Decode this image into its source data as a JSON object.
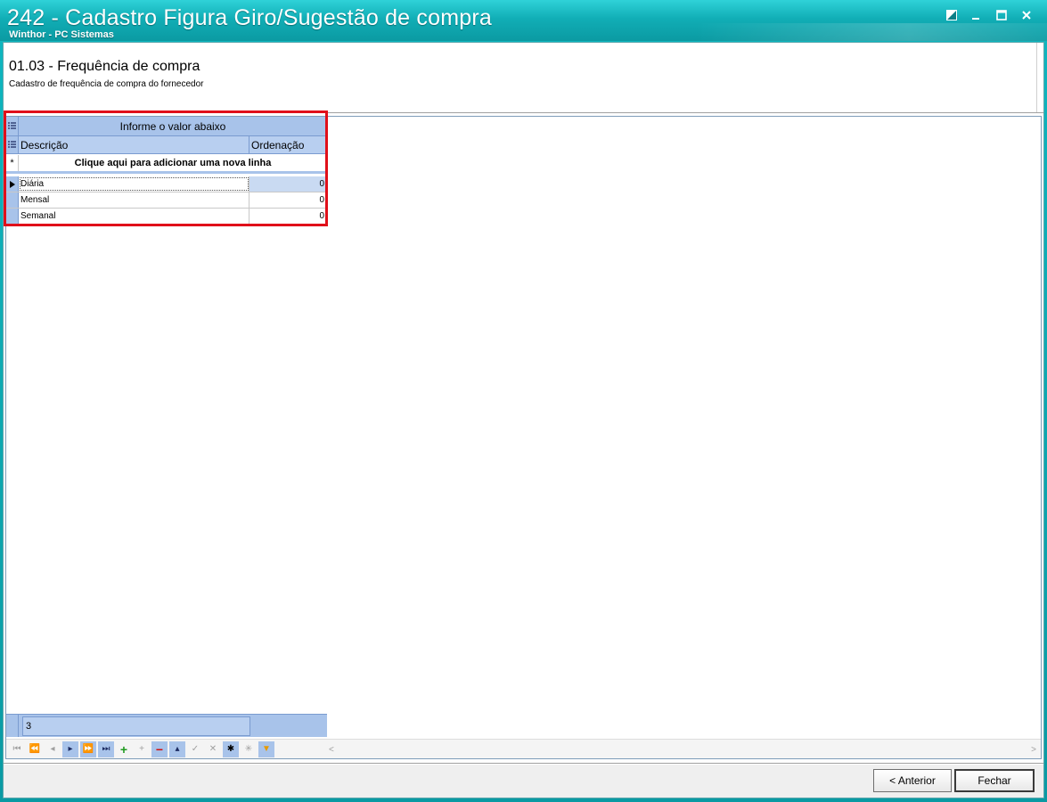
{
  "window": {
    "title": "242 - Cadastro Figura Giro/Sugestão de compra",
    "subtitle": "Winthor - PC Sistemas",
    "controls": [
      "restore-down",
      "minimize",
      "maximize",
      "close"
    ]
  },
  "header": {
    "step_title": "01.03 - Frequência de compra",
    "step_desc": "Cadastro de frequência de compra do fornecedor"
  },
  "grid": {
    "group_header": "Informe o valor abaixo",
    "columns": [
      "Descrição",
      "Ordenação"
    ],
    "new_row_text": "Clique aqui para adicionar uma nova linha",
    "new_row_marker": "*",
    "rows": [
      {
        "descricao": "Diária",
        "ordenacao": "0"
      },
      {
        "descricao": "Mensal",
        "ordenacao": "0"
      },
      {
        "descricao": "Semanal",
        "ordenacao": "0"
      }
    ],
    "selected_row": 0,
    "footer_count": "3"
  },
  "navigator": {
    "buttons": [
      "first",
      "prev-page",
      "prev",
      "next",
      "next-page",
      "last",
      "insert",
      "append",
      "delete",
      "edit",
      "post",
      "cancel",
      "bookmark",
      "goto-bookmark",
      "filter"
    ],
    "scroll_left": "<",
    "scroll_right": ">"
  },
  "buttons": {
    "previous": "< Anterior",
    "close": "Fechar"
  },
  "colors": {
    "titlebar": "#11aeb6",
    "grid_header": "#a8c3ea",
    "highlight": "#e0101a"
  }
}
